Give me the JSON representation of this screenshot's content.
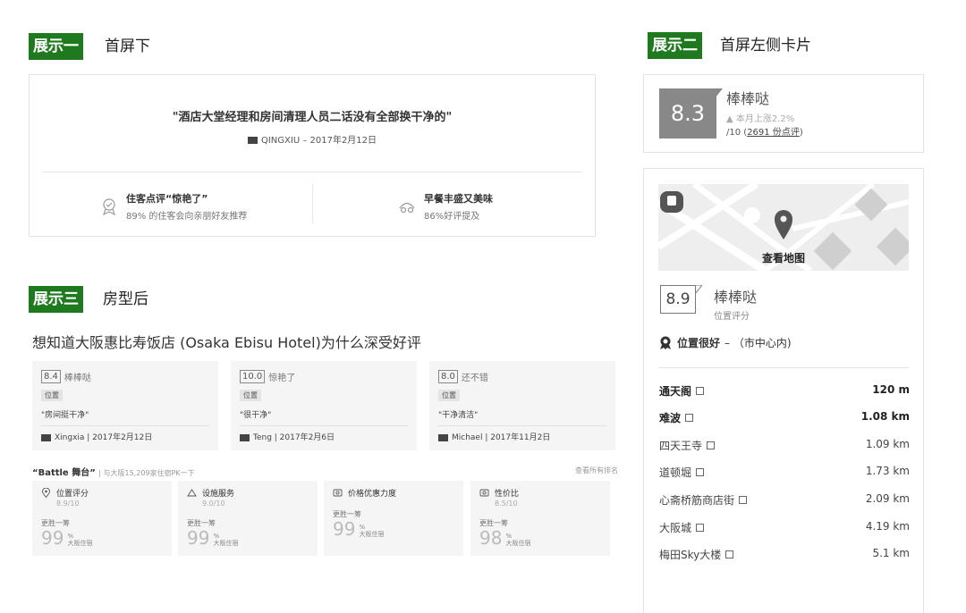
{
  "sections": {
    "one": {
      "tag": "展示一",
      "title": "首屏下"
    },
    "two": {
      "tag": "展示二",
      "title": "首屏左侧卡片"
    },
    "three": {
      "tag": "展示三",
      "title": "房型后"
    }
  },
  "review_card": {
    "quote": "\"酒店大堂经理和房间清理人员二话没有全部换干净的\"",
    "author": "QINGXIU – 2017年2月12日",
    "highlights": [
      {
        "title": "住客点评“惊艳了”",
        "sub": "89% 的住客会向亲朋好友推荐",
        "icon": "award-icon"
      },
      {
        "title": "早餐丰盛又美味",
        "sub": "86%好评提及",
        "icon": "breakfast-icon"
      }
    ]
  },
  "summary_card": {
    "score": "8.3",
    "label": "棒棒哒",
    "trend": "▲ 本月上涨2.2%",
    "total_prefix": "/10 (",
    "total_link": "2691 份点评",
    "total_suffix": ")"
  },
  "location_card": {
    "map_label": "查看地图",
    "score": "8.9",
    "label": "棒棒哒",
    "sub": "位置评分",
    "location_good": "位置很好",
    "location_note": "– （市中心内)",
    "pois": [
      {
        "name": "通天阁",
        "distance": "120 m",
        "bold": true
      },
      {
        "name": "难波",
        "distance": "1.08 km",
        "bold": true
      },
      {
        "name": "四天王寺",
        "distance": "1.09 km",
        "bold": false
      },
      {
        "name": "道顿堀",
        "distance": "1.73 km",
        "bold": false
      },
      {
        "name": "心斋桥筋商店街",
        "distance": "2.09 km",
        "bold": false
      },
      {
        "name": "大阪城",
        "distance": "4.19 km",
        "bold": false
      },
      {
        "name": "梅田Sky大楼",
        "distance": "5.1 km",
        "bold": false
      }
    ]
  },
  "why": {
    "title": "想知道大阪惠比寿饭店 (Osaka Ebisu Hotel)为什么深受好评",
    "reviews": [
      {
        "score": "8.4",
        "label": "棒棒哒",
        "tag": "位置",
        "quote": "\"房间挺干净\"",
        "author": "Xingxia | 2017年2月12日"
      },
      {
        "score": "10.0",
        "label": "惊艳了",
        "tag": "位置",
        "quote": "\"很干净\"",
        "author": "Teng | 2017年2月6日"
      },
      {
        "score": "8.0",
        "label": "还不错",
        "tag": "位置",
        "quote": "\"干净清洁\"",
        "author": "Michael | 2017年11月2日"
      }
    ]
  },
  "battle": {
    "title": "“Battle 舞台”",
    "sub": "| 与大阪15,209家住宿PK一下",
    "see_all": "查看所有排名",
    "items": [
      {
        "name": "位置评分",
        "score": "8.9/10",
        "beat": "更胜一筹",
        "pct": "99",
        "suffix": "大阪住宿",
        "icon": "pin-icon"
      },
      {
        "name": "设施服务",
        "score": "9.0/10",
        "beat": "更胜一筹",
        "pct": "99",
        "suffix": "大阪住宿",
        "icon": "bell-icon"
      },
      {
        "name": "价格优惠力度",
        "score": "",
        "beat": "更胜一筹",
        "pct": "99",
        "suffix": "大阪住宿",
        "icon": "price-icon"
      },
      {
        "name": "性价比",
        "score": "8.5/10",
        "beat": "更胜一筹",
        "pct": "98",
        "suffix": "大阪住宿",
        "icon": "value-icon"
      }
    ]
  }
}
